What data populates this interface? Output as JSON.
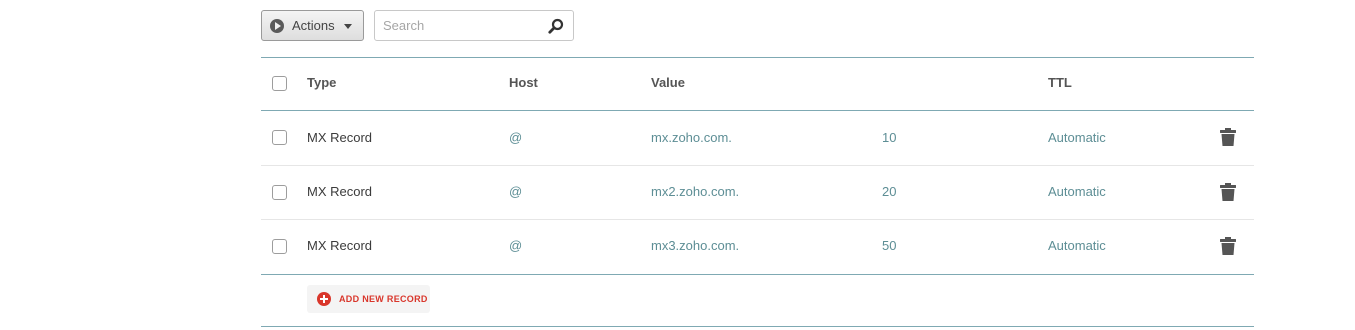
{
  "toolbar": {
    "actions_label": "Actions",
    "search_placeholder": "Search",
    "search_value": ""
  },
  "table": {
    "headers": {
      "type": "Type",
      "host": "Host",
      "value": "Value",
      "ttl": "TTL"
    },
    "rows": [
      {
        "type": "MX Record",
        "host": "@",
        "value": "mx.zoho.com.",
        "priority": "10",
        "ttl": "Automatic"
      },
      {
        "type": "MX Record",
        "host": "@",
        "value": "mx2.zoho.com.",
        "priority": "20",
        "ttl": "Automatic"
      },
      {
        "type": "MX Record",
        "host": "@",
        "value": "mx3.zoho.com.",
        "priority": "50",
        "ttl": "Automatic"
      }
    ],
    "add_label": "ADD NEW RECORD"
  },
  "icons": {
    "actions": "play-circle-icon",
    "dropdown": "caret-down-icon",
    "search": "magnifier-icon",
    "delete": "trash-icon",
    "add": "plus-circle-icon"
  },
  "colors": {
    "accent_teal": "#5d8e95",
    "divider_teal": "#7fa9b3",
    "add_red": "#d9362b"
  }
}
